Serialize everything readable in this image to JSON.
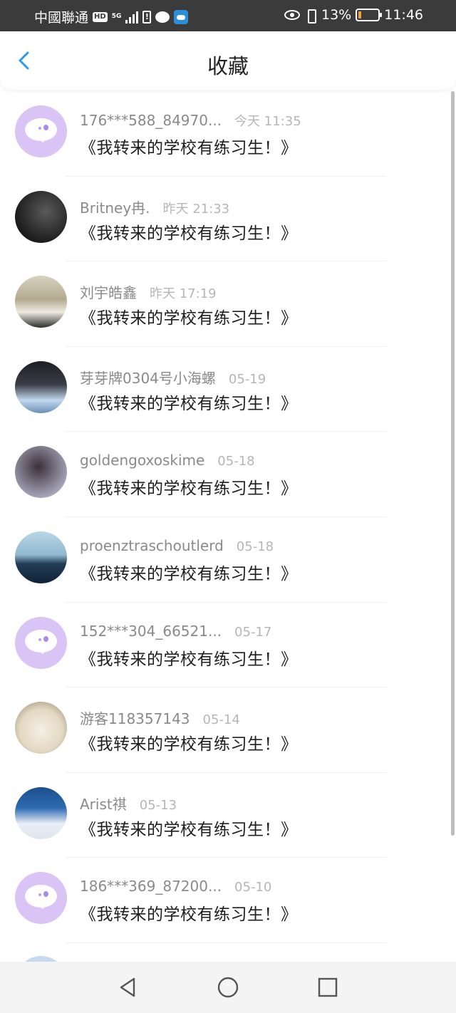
{
  "status_bar": {
    "carrier": "中國聯通",
    "hd": "HD",
    "network": "5G",
    "battery_percent": "13%",
    "battery_level": 0.13,
    "time": "11:46",
    "colors": {
      "background": "#3b3b3b",
      "battery_fill": "#f0a23b"
    }
  },
  "header": {
    "title": "收藏",
    "back_icon": "chevron-left-icon",
    "accent_color": "#2a9be8"
  },
  "favorites": [
    {
      "username": "176***588_84970...",
      "time": "今天 11:35",
      "message": "《我转来的学校有练习生！》",
      "avatar": "bot"
    },
    {
      "username": "Britney冉.",
      "time": "昨天 21:33",
      "message": "《我转来的学校有练习生！》",
      "avatar": "photo1"
    },
    {
      "username": "刘宇皓鑫",
      "time": "昨天 17:19",
      "message": "《我转来的学校有练习生！》",
      "avatar": "photo2"
    },
    {
      "username": "芽芽牌0304号小海螺",
      "time": "05-19",
      "message": "《我转来的学校有练习生！》",
      "avatar": "photo3"
    },
    {
      "username": "goldengoxoskime",
      "time": "05-18",
      "message": "《我转来的学校有练习生！》",
      "avatar": "photo4"
    },
    {
      "username": "proenztraschoutlerd",
      "time": "05-18",
      "message": "《我转来的学校有练习生！》",
      "avatar": "photo5"
    },
    {
      "username": "152***304_66521...",
      "time": "05-17",
      "message": "《我转来的学校有练习生！》",
      "avatar": "bot"
    },
    {
      "username": "游客118357143",
      "time": "05-14",
      "message": "《我转来的学校有练习生！》",
      "avatar": "photo6"
    },
    {
      "username": "Arist祺",
      "time": "05-13",
      "message": "《我转来的学校有练习生！》",
      "avatar": "photo7"
    },
    {
      "username": "186***369_87200...",
      "time": "05-10",
      "message": "《我转来的学校有练习生！》",
      "avatar": "bot"
    }
  ],
  "nav_bar": {
    "back": "triangle-back-icon",
    "home": "circle-home-icon",
    "recents": "square-recents-icon"
  }
}
